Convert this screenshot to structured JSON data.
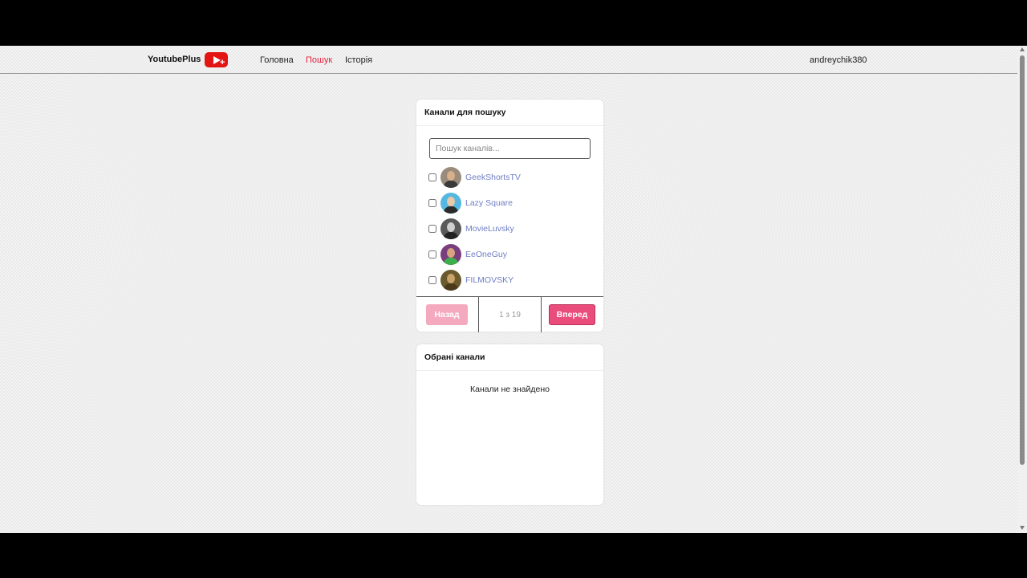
{
  "navbar": {
    "brand": "YoutubePlus",
    "logo_plus": "+",
    "links": [
      {
        "label": "Головна",
        "active": false
      },
      {
        "label": "Пошук",
        "active": true
      },
      {
        "label": "Історія",
        "active": false
      }
    ],
    "username": "andreychik380"
  },
  "search_card": {
    "title": "Канали для пошуку",
    "search_placeholder": "Пошук каналів...",
    "channels": [
      {
        "name": "GeekShortsTV",
        "checked": false
      },
      {
        "name": "Lazy Square",
        "checked": false
      },
      {
        "name": "MovieLuvsky",
        "checked": false
      },
      {
        "name": "EeOneGuy",
        "checked": false
      },
      {
        "name": "FILMOVSKY",
        "checked": false
      }
    ],
    "pager": {
      "prev_label": "Назад",
      "page_text": "1 з 19",
      "next_label": "Вперед"
    }
  },
  "selected_card": {
    "title": "Обрані канали",
    "empty_text": "Канали не знайдено"
  },
  "colors": {
    "accent": "#e0223f",
    "next_button": "#ea4c7c",
    "prev_button_disabled": "#f4a9bf",
    "channel_link": "#6f7ec4",
    "youtube_red": "#e21414"
  }
}
